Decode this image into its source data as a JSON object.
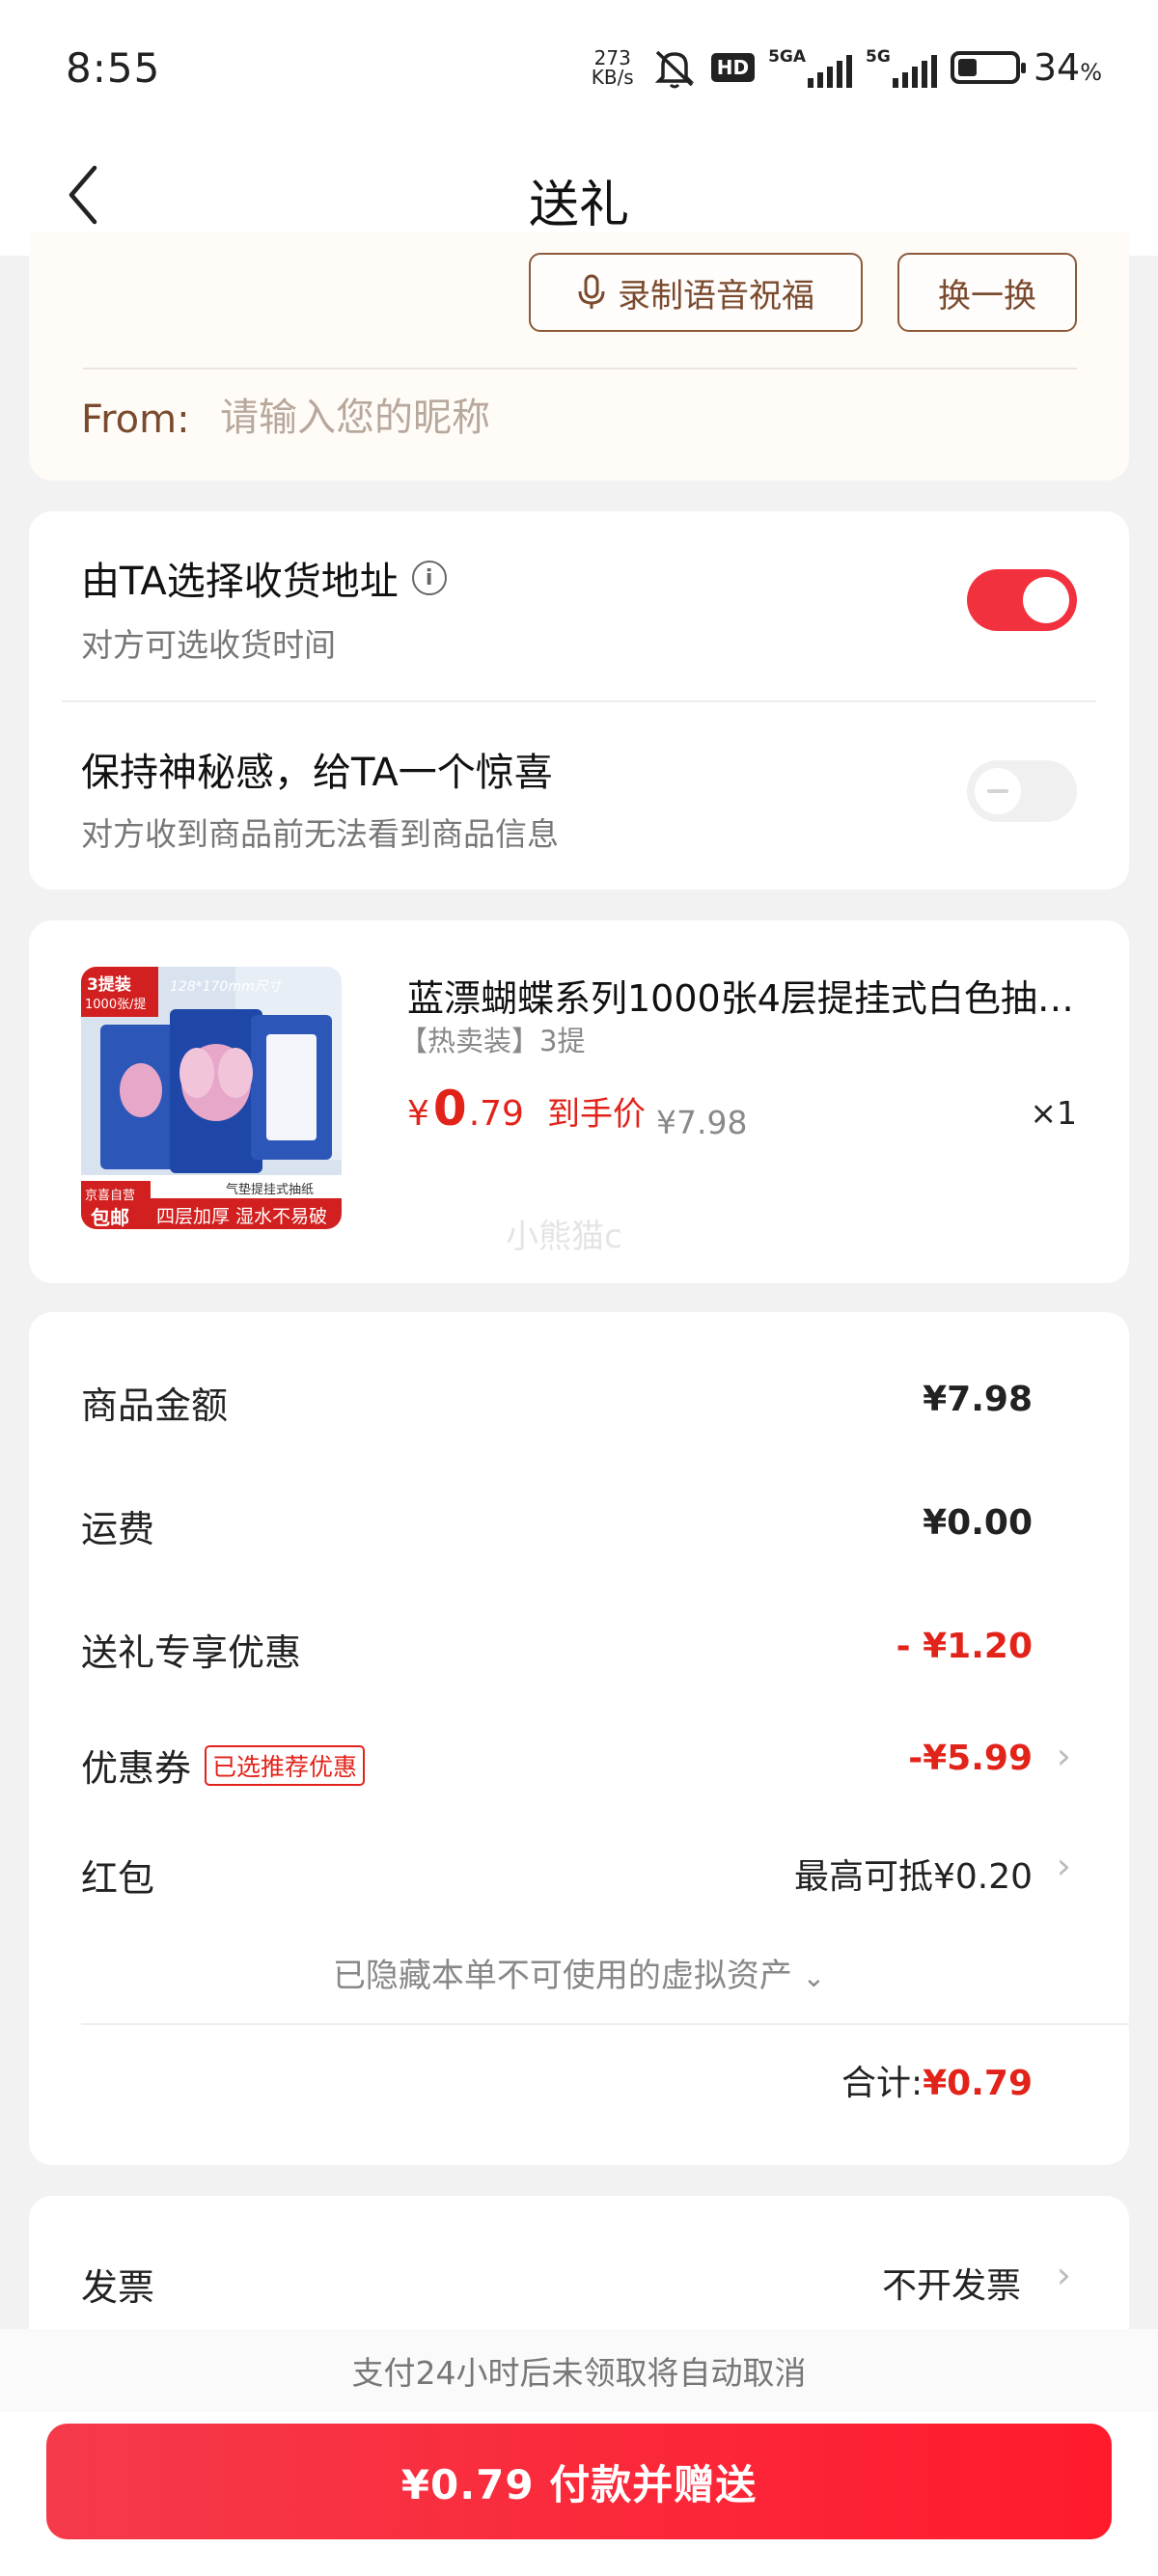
{
  "status_bar": {
    "time": "8:55",
    "net_speed_value": "273",
    "net_speed_unit": "KB/s",
    "hd_badge": "HD",
    "signal1_label": "5GA",
    "signal2_label": "5G",
    "battery_percent": "34",
    "battery_level": 0.34,
    "percent_sign": "%"
  },
  "nav": {
    "title": "送礼",
    "back_icon": "chevron-left-icon"
  },
  "message_card": {
    "voice_button_label": "录制语音祝福",
    "swap_button_label": "换一换",
    "from_label": "From:",
    "from_placeholder": "请输入您的昵称",
    "from_value": ""
  },
  "options_card": {
    "address_title": "由TA选择收货地址",
    "address_sub": "对方可选收货时间",
    "address_toggle_on": true,
    "mystery_title": "保持神秘感，给TA一个惊喜",
    "mystery_sub": "对方收到商品前无法看到商品信息",
    "mystery_toggle_on": false
  },
  "product": {
    "name": "蓝漂蝴蝶系列1000张4层提挂式白色抽…",
    "spec": "【热卖装】3提",
    "price_symbol": "¥",
    "price_int": "0",
    "price_dec": ".79",
    "price_tag": "到手价",
    "original_price": "¥7.98",
    "quantity": "×1",
    "image_badge": "3提装",
    "image_badge_sub": "1000张/提",
    "image_corner_top": "京喜自营",
    "image_corner_bottom": "包邮",
    "image_footer_top": "气垫提挂式抽纸",
    "image_footer": "四层加厚 湿水不易破",
    "image_size_text": "128*170mm尺寸",
    "watermark": "小熊猫c"
  },
  "amounts": {
    "goods_label": "商品金额",
    "goods_value": "¥7.98",
    "shipping_label": "运费",
    "shipping_value": "¥0.00",
    "gift_discount_label": "送礼专享优惠",
    "gift_discount_value": "- ¥1.20",
    "coupon_label": "优惠券",
    "coupon_tag": "已选推荐优惠",
    "coupon_value": "-¥5.99",
    "redpacket_label": "红包",
    "redpacket_value": "最高可抵¥0.20",
    "hidden_assets": "已隐藏本单不可使用的虚拟资产",
    "total_label": "合计:",
    "total_value": "¥0.79"
  },
  "invoice": {
    "label": "发票",
    "value": "不开发票"
  },
  "bottom": {
    "notice": "支付24小时后未领取将自动取消",
    "pay_button": "¥0.79 付款并赠送"
  },
  "colors": {
    "accent_red": "#e2231a",
    "button_red": "#ff1a2c",
    "brown": "#7a4a2e"
  }
}
